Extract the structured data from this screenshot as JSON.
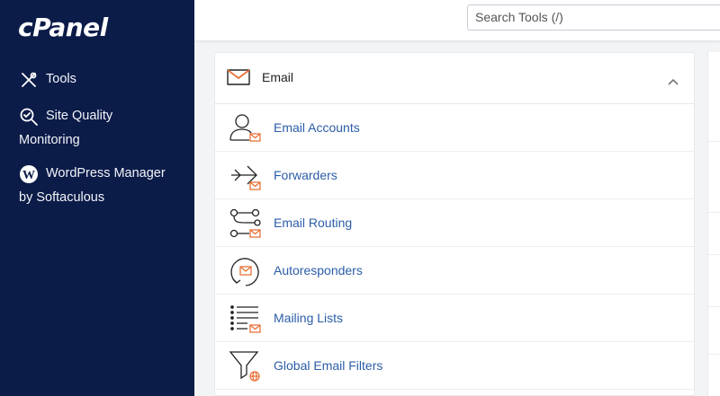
{
  "brand": {
    "logo_text": "cPanel"
  },
  "sidebar": {
    "items": [
      {
        "label": "Tools",
        "icon": "tools-icon"
      },
      {
        "label_line1": "Site Quality",
        "label_line2": "Monitoring",
        "icon": "magnifier-icon"
      },
      {
        "label_line1": "WordPress Manager",
        "label_line2": "by Softaculous",
        "icon": "wordpress-icon"
      }
    ]
  },
  "search": {
    "placeholder": "Search Tools (/)"
  },
  "section": {
    "title": "Email",
    "expanded": true,
    "items": [
      {
        "label": "Email Accounts",
        "icon": "email-accounts-icon"
      },
      {
        "label": "Forwarders",
        "icon": "forwarders-icon"
      },
      {
        "label": "Email Routing",
        "icon": "email-routing-icon"
      },
      {
        "label": "Autoresponders",
        "icon": "autoresponders-icon"
      },
      {
        "label": "Mailing Lists",
        "icon": "mailing-lists-icon"
      },
      {
        "label": "Global Email Filters",
        "icon": "global-email-filters-icon"
      }
    ]
  },
  "colors": {
    "sidebar_bg": "#0c1c49",
    "link": "#2b5da8",
    "accent_orange": "#e8733a"
  }
}
